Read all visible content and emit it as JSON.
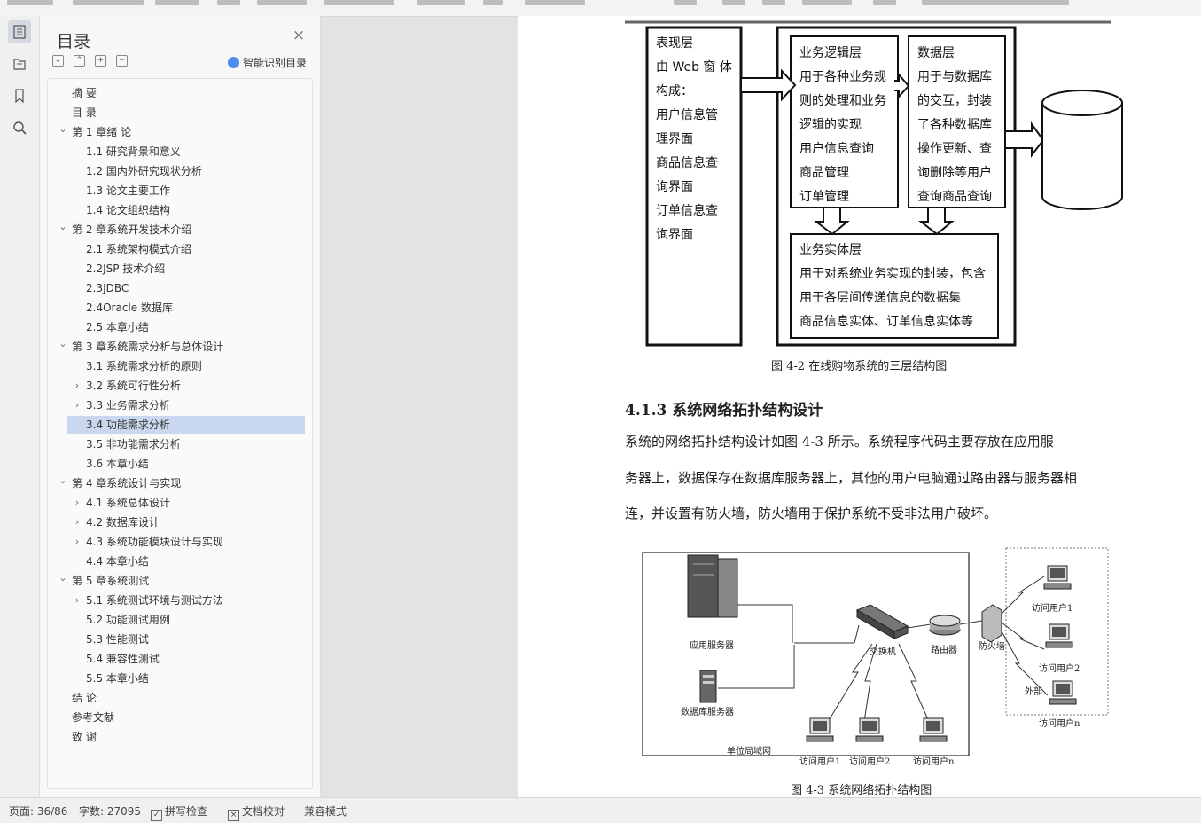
{
  "nav": {
    "title": "目录",
    "ai_toc_label": "智能识别目录",
    "items": [
      {
        "label": "摘  要",
        "level": 0,
        "chevron": ""
      },
      {
        "label": "目  录",
        "level": 0,
        "chevron": ""
      },
      {
        "label": "第 1 章绪  论",
        "level": 0,
        "chevron": "open"
      },
      {
        "label": "1.1 研究背景和意义",
        "level": 1,
        "chevron": ""
      },
      {
        "label": "1.2 国内外研究现状分析",
        "level": 1,
        "chevron": ""
      },
      {
        "label": "1.3 论文主要工作",
        "level": 1,
        "chevron": ""
      },
      {
        "label": "1.4 论文组织结构",
        "level": 1,
        "chevron": ""
      },
      {
        "label": "第 2 章系统开发技术介绍",
        "level": 0,
        "chevron": "open"
      },
      {
        "label": "2.1 系统架构模式介绍",
        "level": 1,
        "chevron": ""
      },
      {
        "label": "2.2JSP 技术介绍",
        "level": 1,
        "chevron": ""
      },
      {
        "label": "2.3JDBC",
        "level": 1,
        "chevron": ""
      },
      {
        "label": "2.4Oracle 数据库",
        "level": 1,
        "chevron": ""
      },
      {
        "label": "2.5 本章小结",
        "level": 1,
        "chevron": ""
      },
      {
        "label": "第 3 章系统需求分析与总体设计",
        "level": 0,
        "chevron": "open"
      },
      {
        "label": "3.1 系统需求分析的原则",
        "level": 1,
        "chevron": ""
      },
      {
        "label": "3.2 系统可行性分析",
        "level": 1,
        "chevron": "closed"
      },
      {
        "label": "3.3 业务需求分析",
        "level": 1,
        "chevron": "closed"
      },
      {
        "label": "3.4 功能需求分析",
        "level": 1,
        "chevron": "",
        "selected": true
      },
      {
        "label": "3.5 非功能需求分析",
        "level": 1,
        "chevron": ""
      },
      {
        "label": "3.6 本章小结",
        "level": 1,
        "chevron": ""
      },
      {
        "label": "第 4 章系统设计与实现",
        "level": 0,
        "chevron": "open"
      },
      {
        "label": "4.1 系统总体设计",
        "level": 1,
        "chevron": "closed"
      },
      {
        "label": "4.2 数据库设计",
        "level": 1,
        "chevron": "closed"
      },
      {
        "label": "4.3 系统功能模块设计与实现",
        "level": 1,
        "chevron": "closed"
      },
      {
        "label": "4.4 本章小结",
        "level": 1,
        "chevron": ""
      },
      {
        "label": "第 5 章系统测试",
        "level": 0,
        "chevron": "open"
      },
      {
        "label": "5.1 系统测试环境与测试方法",
        "level": 1,
        "chevron": "closed"
      },
      {
        "label": "5.2 功能测试用例",
        "level": 1,
        "chevron": ""
      },
      {
        "label": "5.3 性能测试",
        "level": 1,
        "chevron": ""
      },
      {
        "label": "5.4 兼容性测试",
        "level": 1,
        "chevron": ""
      },
      {
        "label": "5.5 本章小结",
        "level": 1,
        "chevron": ""
      },
      {
        "label": "结  论",
        "level": 0,
        "chevron": ""
      },
      {
        "label": "参考文献",
        "level": 0,
        "chevron": ""
      },
      {
        "label": "致  谢",
        "level": 0,
        "chevron": ""
      }
    ]
  },
  "status": {
    "page": "页面: 36/86",
    "words": "字数: 27095",
    "spell": "拼写检查",
    "proof": "文档校对",
    "compat": "兼容模式"
  },
  "doc": {
    "fig2": {
      "presentation": [
        "表现层",
        "由 Web 窗 体",
        "构成：",
        "用户信息管",
        "理界面",
        "商品信息查",
        "询界面",
        "订单信息查",
        "询界面"
      ],
      "business": [
        "业务逻辑层",
        "用于各种业务规",
        "则的处理和业务",
        "逻辑的实现",
        "用户信息查询",
        "商品管理",
        "订单管理"
      ],
      "data": [
        "数据层",
        "用于与数据库",
        "的交互，封装",
        "了各种数据库",
        "操作更新、查",
        "询删除等用户",
        "查询商品查询"
      ],
      "entity": [
        "业务实体层",
        "用于对系统业务实现的封装，包含",
        "用于各层间传递信息的数据集",
        "商品信息实体、订单信息实体等"
      ],
      "caption": "图 4-2   在线购物系统的三层结构图"
    },
    "section_heading": "4.1.3 系统网络拓扑结构设计",
    "paragraph_lines": [
      "系统的网络拓扑结构设计如图 4-3 所示。系统程序代码主要存放在应用服",
      "务器上，数据保存在数据库服务器上，其他的用户电脑通过路由器与服务器相",
      "连，并设置有防火墙，防火墙用于保护系统不受非法用户破坏。"
    ],
    "fig3": {
      "app_server": "应用服务器",
      "db_server": "数据库服务器",
      "switch": "交换机",
      "router": "路由器",
      "firewall": "防火墙",
      "lan": "单位局域网",
      "external": "外部",
      "lan_users": [
        "访问用户1",
        "访问用户2",
        "访问用户n"
      ],
      "ext_users": [
        "访问用户1",
        "访问用户2",
        "访问用户n"
      ],
      "caption": "图 4-3   系统网络拓扑结构图"
    }
  }
}
